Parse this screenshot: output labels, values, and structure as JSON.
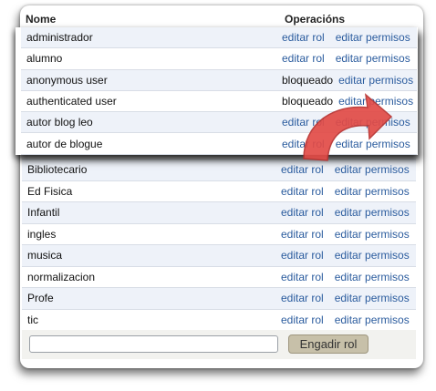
{
  "table": {
    "headers": {
      "name": "Nome",
      "operations": "Operacións"
    },
    "rows": [
      {
        "name": "administrador",
        "op1": "editar rol",
        "op2": "editar permisos"
      },
      {
        "name": "alumno",
        "op1": "editar rol",
        "op2": "editar permisos"
      },
      {
        "name": "anonymous user",
        "op1": "bloqueado",
        "op2": "editar permisos"
      },
      {
        "name": "authenticated user",
        "op1": "bloqueado",
        "op2": "editar permisos"
      },
      {
        "name": "autor blog leo",
        "op1": "editar rol",
        "op2": "editar permisos"
      },
      {
        "name": "autor de blogue",
        "op1": "editar rol",
        "op2": "editar permisos"
      },
      {
        "name": "Bibliotecario",
        "op1": "editar rol",
        "op2": "editar permisos"
      },
      {
        "name": "Ed Fisica",
        "op1": "editar rol",
        "op2": "editar permisos"
      },
      {
        "name": "Infantil",
        "op1": "editar rol",
        "op2": "editar permisos"
      },
      {
        "name": "ingles",
        "op1": "editar rol",
        "op2": "editar permisos"
      },
      {
        "name": "musica",
        "op1": "editar rol",
        "op2": "editar permisos"
      },
      {
        "name": "normalizacion",
        "op1": "editar rol",
        "op2": "editar permisos"
      },
      {
        "name": "Profe",
        "op1": "editar rol",
        "op2": "editar permisos"
      },
      {
        "name": "tic",
        "op1": "editar rol",
        "op2": "editar permisos"
      }
    ]
  },
  "form": {
    "new_role_value": "",
    "add_button_label": "Engadir rol"
  },
  "annotation": {
    "icon": "curved-arrow-icon",
    "color": "#e24b47"
  },
  "colors": {
    "link": "#2b5c9e",
    "row_alt": "#eef2f9",
    "button": "#c7c0a9"
  }
}
